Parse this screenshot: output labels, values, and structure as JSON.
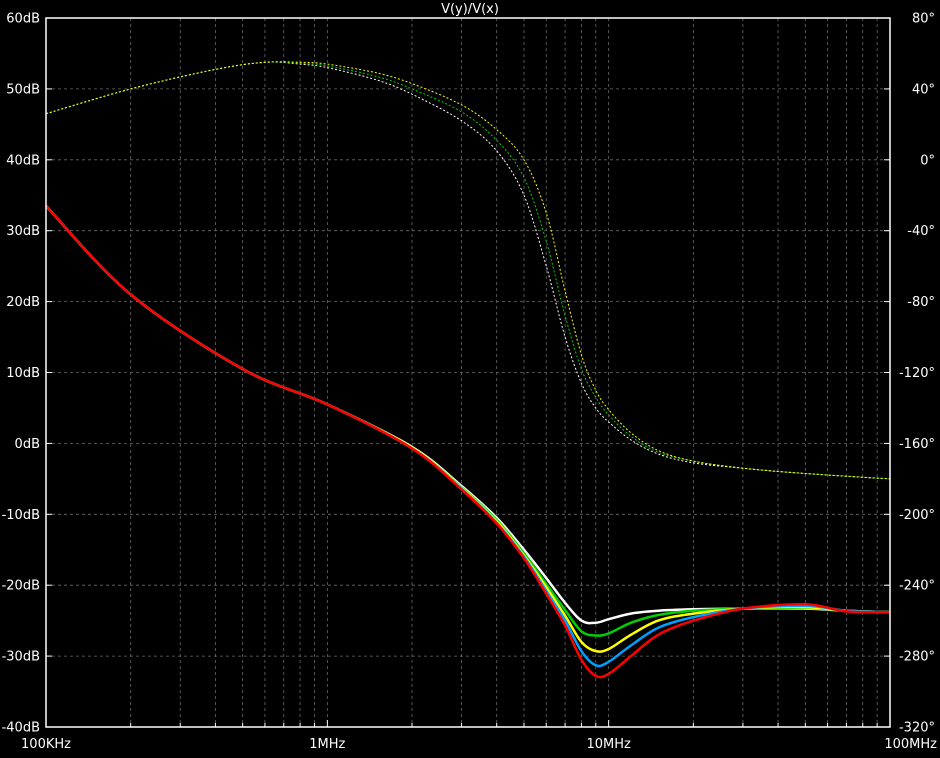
{
  "chart_data": {
    "type": "line",
    "title": "V(y)/V(x)",
    "x_scale": "log",
    "xlim": [
      100000,
      100000000
    ],
    "ylim_left": [
      -40,
      60
    ],
    "ylim_right": [
      -320,
      80
    ],
    "grid": true,
    "x_ticks": [
      {
        "value": 100000,
        "label": "100KHz"
      },
      {
        "value": 1000000,
        "label": "1MHz"
      },
      {
        "value": 10000000,
        "label": "10MHz"
      },
      {
        "value": 100000000,
        "label": "100MHz"
      }
    ],
    "y_left_ticks": [
      {
        "value": 60,
        "label": "60dB"
      },
      {
        "value": 50,
        "label": "50dB"
      },
      {
        "value": 40,
        "label": "40dB"
      },
      {
        "value": 30,
        "label": "30dB"
      },
      {
        "value": 20,
        "label": "20dB"
      },
      {
        "value": 10,
        "label": "10dB"
      },
      {
        "value": 0,
        "label": "0dB"
      },
      {
        "value": -10,
        "label": "-10dB"
      },
      {
        "value": -20,
        "label": "-20dB"
      },
      {
        "value": -30,
        "label": "-30dB"
      },
      {
        "value": -40,
        "label": "-40dB"
      }
    ],
    "y_right_ticks": [
      {
        "value": 80,
        "label": "80°"
      },
      {
        "value": 40,
        "label": "40°"
      },
      {
        "value": 0,
        "label": "0°"
      },
      {
        "value": -40,
        "label": "-40°"
      },
      {
        "value": -80,
        "label": "-80°"
      },
      {
        "value": -120,
        "label": "-120°"
      },
      {
        "value": -160,
        "label": "-160°"
      },
      {
        "value": -200,
        "label": "-200°"
      },
      {
        "value": -240,
        "label": "-240°"
      },
      {
        "value": -280,
        "label": "-280°"
      },
      {
        "value": -320,
        "label": "-320°"
      }
    ],
    "magnitude_series": [
      {
        "color": "#ffffff",
        "x": [
          100000,
          200000,
          500000,
          1000000,
          2000000,
          3000000,
          4000000,
          5000000,
          6000000,
          7000000,
          8000000,
          9000000,
          10000000,
          12000000,
          15000000,
          20000000,
          30000000,
          50000000,
          70000000,
          100000000
        ],
        "y": [
          33.5,
          21,
          10.5,
          5.5,
          -0.5,
          -6,
          -10.5,
          -15,
          -19,
          -22.5,
          -25,
          -25.3,
          -24.8,
          -24,
          -23.6,
          -23.4,
          -23.3,
          -23.3,
          -23.6,
          -23.8
        ]
      },
      {
        "color": "#00d000",
        "x": [
          100000,
          200000,
          500000,
          1000000,
          2000000,
          3000000,
          4000000,
          5000000,
          6000000,
          7000000,
          8000000,
          9000000,
          10000000,
          12000000,
          15000000,
          20000000,
          30000000,
          50000000,
          70000000,
          100000000
        ],
        "y": [
          33.5,
          21,
          10.5,
          5.5,
          -0.6,
          -6.2,
          -10.8,
          -15.5,
          -19.8,
          -23.5,
          -26.5,
          -27.1,
          -26.8,
          -25.3,
          -24.2,
          -23.6,
          -23.3,
          -23.2,
          -23.6,
          -23.8
        ]
      },
      {
        "color": "#ffff00",
        "x": [
          100000,
          200000,
          500000,
          1000000,
          2000000,
          3000000,
          4000000,
          5000000,
          6000000,
          7000000,
          8000000,
          9000000,
          10000000,
          12000000,
          15000000,
          20000000,
          30000000,
          50000000,
          70000000,
          100000000
        ],
        "y": [
          33.5,
          21,
          10.5,
          5.5,
          -0.6,
          -6.3,
          -11,
          -15.8,
          -20.3,
          -24.3,
          -28,
          -29.3,
          -29,
          -27,
          -25,
          -24,
          -23.3,
          -23.1,
          -23.6,
          -23.8
        ]
      },
      {
        "color": "#00a0ff",
        "x": [
          100000,
          200000,
          500000,
          1000000,
          2000000,
          3000000,
          4000000,
          5000000,
          6000000,
          7000000,
          8000000,
          9000000,
          10000000,
          12000000,
          15000000,
          20000000,
          30000000,
          50000000,
          70000000,
          100000000
        ],
        "y": [
          33.5,
          21,
          10.5,
          5.5,
          -0.7,
          -6.4,
          -11.2,
          -16,
          -20.8,
          -25,
          -29.3,
          -31.3,
          -30.8,
          -28.5,
          -26,
          -24.5,
          -23.3,
          -22.9,
          -23.6,
          -23.8
        ]
      },
      {
        "color": "#ff0000",
        "x": [
          100000,
          200000,
          500000,
          1000000,
          2000000,
          3000000,
          4000000,
          5000000,
          6000000,
          7000000,
          8000000,
          9000000,
          10000000,
          12000000,
          15000000,
          20000000,
          30000000,
          50000000,
          70000000,
          100000000
        ],
        "y": [
          33.5,
          21,
          10.5,
          5.5,
          -0.7,
          -6.5,
          -11.3,
          -16.2,
          -21.2,
          -25.7,
          -30.5,
          -32.8,
          -32.5,
          -30,
          -27,
          -25,
          -23.3,
          -22.7,
          -23.7,
          -23.8
        ]
      }
    ],
    "phase_series": [
      {
        "color": "#ffffff",
        "x": [
          100000,
          200000,
          400000,
          600000,
          800000,
          1000000,
          1500000,
          2000000,
          3000000,
          4000000,
          5000000,
          6000000,
          7000000,
          8000000,
          9000000,
          10000000,
          12000000,
          15000000,
          20000000,
          30000000,
          50000000,
          100000000
        ],
        "y": [
          26,
          40,
          51,
          55,
          54,
          52,
          45,
          37,
          22,
          5,
          -20,
          -60,
          -100,
          -126,
          -140,
          -148,
          -158,
          -166,
          -171,
          -174,
          -177,
          -180
        ]
      },
      {
        "color": "#00d000",
        "x": [
          100000,
          200000,
          400000,
          600000,
          800000,
          1000000,
          1500000,
          2000000,
          3000000,
          4000000,
          5000000,
          6000000,
          7000000,
          8000000,
          9000000,
          10000000,
          12000000,
          15000000,
          20000000,
          30000000,
          50000000,
          100000000
        ],
        "y": [
          26,
          40,
          51,
          55,
          54.5,
          53,
          47,
          40,
          27,
          11,
          -10,
          -46,
          -88,
          -118,
          -134,
          -144,
          -156,
          -165,
          -170,
          -174,
          -177,
          -180
        ]
      },
      {
        "color": "#ffff00",
        "x": [
          100000,
          200000,
          400000,
          600000,
          800000,
          1000000,
          1500000,
          2000000,
          3000000,
          4000000,
          5000000,
          6000000,
          7000000,
          8000000,
          9000000,
          10000000,
          12000000,
          15000000,
          20000000,
          30000000,
          50000000,
          100000000
        ],
        "y": [
          26,
          40,
          51,
          55,
          55,
          54,
          49,
          43,
          31,
          17,
          0,
          -30,
          -74,
          -110,
          -130,
          -141,
          -154,
          -164,
          -170,
          -174,
          -177,
          -180
        ]
      }
    ]
  }
}
